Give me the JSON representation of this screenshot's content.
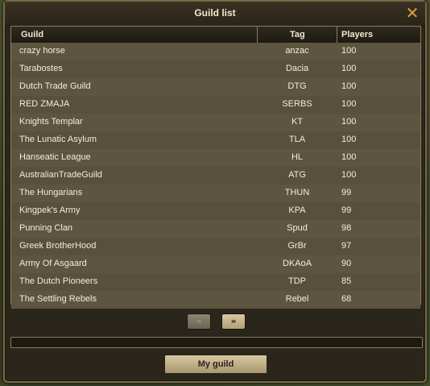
{
  "window": {
    "title": "Guild list"
  },
  "table": {
    "headers": {
      "guild": "Guild",
      "tag": "Tag",
      "players": "Players"
    },
    "rows": [
      {
        "guild": "crazy horse",
        "tag": "anzac",
        "players": "100"
      },
      {
        "guild": "Tarabostes",
        "tag": "Dacia",
        "players": "100"
      },
      {
        "guild": "Dutch Trade Guild",
        "tag": "DTG",
        "players": "100"
      },
      {
        "guild": "RED ZMAJA",
        "tag": "SERBS",
        "players": "100"
      },
      {
        "guild": "Knights Templar",
        "tag": "KT",
        "players": "100"
      },
      {
        "guild": "The Lunatic Asylum",
        "tag": "TLA",
        "players": "100"
      },
      {
        "guild": "Hanseatic League",
        "tag": "HL",
        "players": "100"
      },
      {
        "guild": "AustralianTradeGuild",
        "tag": "ATG",
        "players": "100"
      },
      {
        "guild": "The Hungarians",
        "tag": "THUN",
        "players": "99"
      },
      {
        "guild": "Kingpek's Army",
        "tag": "KPA",
        "players": "99"
      },
      {
        "guild": "Punning Clan",
        "tag": "Spud",
        "players": "98"
      },
      {
        "guild": "Greek BrotherHood",
        "tag": "GrBr",
        "players": "97"
      },
      {
        "guild": "Army Of Asgaard",
        "tag": "DKAoA",
        "players": "90"
      },
      {
        "guild": "The Dutch Pioneers",
        "tag": "TDP",
        "players": "85"
      },
      {
        "guild": "The Settling Rebels",
        "tag": "Rebel",
        "players": "68"
      }
    ]
  },
  "pager": {
    "prev_label": "«",
    "next_label": "»"
  },
  "footer": {
    "my_guild_label": "My guild"
  }
}
